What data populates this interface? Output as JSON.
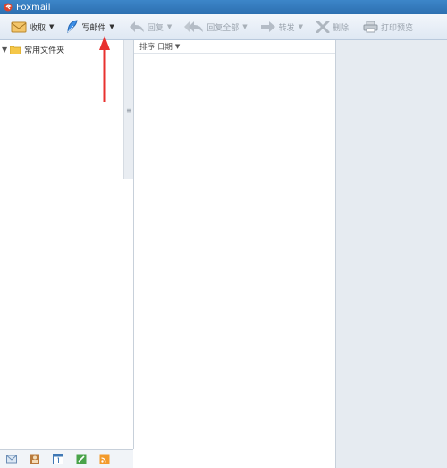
{
  "window": {
    "title": "Foxmail"
  },
  "toolbar": {
    "receive_label": "收取",
    "compose_label": "写邮件",
    "reply_label": "回复",
    "reply_all_label": "回复全部",
    "forward_label": "转发",
    "delete_label": "删除",
    "print_preview_label": "打印预览"
  },
  "sidebar": {
    "folder_label": "常用文件夹"
  },
  "message_list": {
    "sort_label": "排序:日期"
  },
  "bottom_bar": {
    "icons": [
      "mail-icon",
      "contacts-icon",
      "calendar-icon",
      "notes-icon",
      "rss-icon"
    ]
  },
  "colors": {
    "annotation_arrow": "#e8312f",
    "titlebar": "#2f76b8",
    "preview_bg": "#e6ebf1"
  }
}
